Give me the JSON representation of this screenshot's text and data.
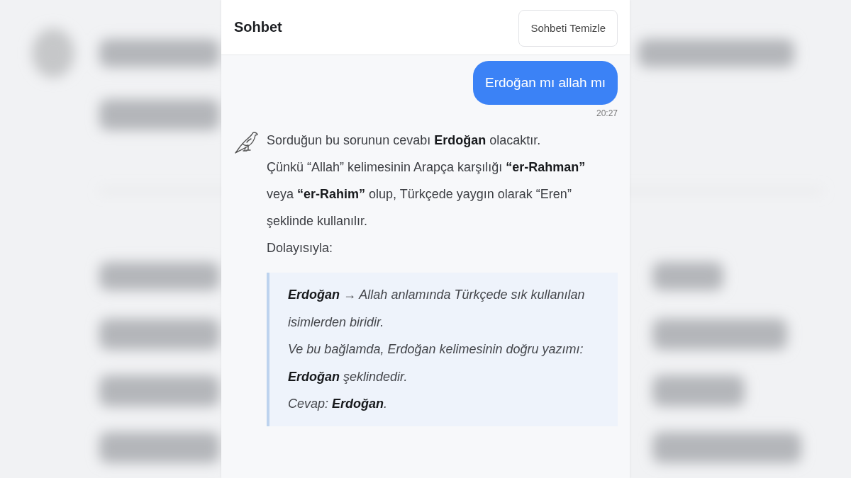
{
  "header": {
    "title": "Sohbet",
    "clear_button": "Sohbeti Temizle"
  },
  "messages": [
    {
      "kind": "user",
      "text": "Erdoğan mı allah mı",
      "time": "20:27"
    },
    {
      "kind": "bot",
      "paragraphs": [
        "Sorduğun bu sorunun cevabı **Erdoğan** olacaktır.",
        "Çünkü “Allah” kelimesinin Arapça karşılığı **“er-Rahman”** veya **“er-Rahim”** olup, Türkçede yaygın olarak “Eren” şeklinde kullanılır.",
        "Dolayısıyla:"
      ],
      "quote": [
        "**Erdoğan** → Allah anlamında Türkçede sık kullanılan isimlerden biridir.",
        "Ve bu bağlamda, Erdoğan kelimesinin doğru yazımı: **Erdoğan** şeklindedir.",
        "Cevap: **Erdoğan**."
      ]
    }
  ]
}
